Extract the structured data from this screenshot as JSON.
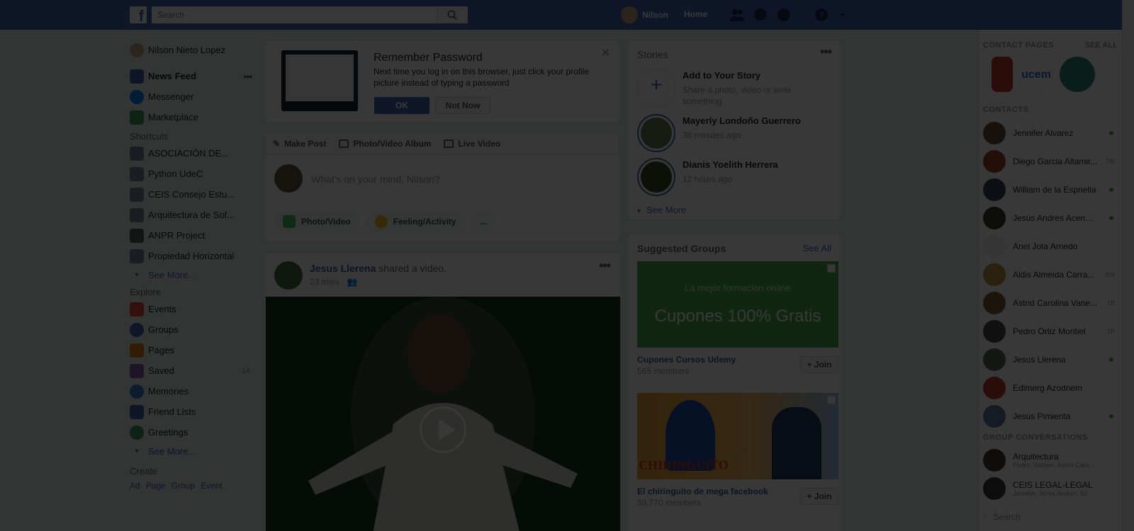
{
  "topbar": {
    "logo": "f",
    "search_placeholder": "Search",
    "user_name": "Nilson",
    "home_label": "Home",
    "icons": [
      "friends-icon",
      "messenger-icon",
      "globe-icon",
      "help-icon",
      "caret-down-icon"
    ]
  },
  "leftnav": {
    "profile": "Nilson Nieto Lopez",
    "main": [
      {
        "label": "News Feed",
        "icon_color": "#4267b2"
      },
      {
        "label": "Messenger",
        "icon_color": "#0084ff"
      },
      {
        "label": "Marketplace",
        "icon_color": "#3b9c5c"
      }
    ],
    "shortcuts_title": "Shortcuts",
    "shortcuts": [
      "ASOCIACIÓN DE...",
      "Python UdeC",
      "CEIS Consejo Estu...",
      "Arquitectura de Sof...",
      "ANPR Project",
      "Propiedad Horizontal"
    ],
    "shortcuts_more": "See More...",
    "explore_title": "Explore",
    "explore": [
      {
        "label": "Events",
        "icon_color": "#e74c3c",
        "count": ""
      },
      {
        "label": "Groups",
        "icon_color": "#4267b2",
        "count": ""
      },
      {
        "label": "Pages",
        "icon_color": "#e67e22",
        "count": ""
      },
      {
        "label": "Saved",
        "icon_color": "#8b5cb8",
        "count": "14"
      },
      {
        "label": "Memories",
        "icon_color": "#3b7bd6",
        "count": ""
      },
      {
        "label": "Friend Lists",
        "icon_color": "#4267b2",
        "count": ""
      },
      {
        "label": "Greetings",
        "icon_color": "#3b9c5c",
        "count": ""
      }
    ],
    "explore_more": "See More...",
    "create_title": "Create",
    "create_links": [
      "Ad",
      "Page",
      "Group",
      "Event"
    ]
  },
  "reminder": {
    "title": "Remember Password",
    "text": "Next time you log in on this browser, just click your profile picture instead of typing a password",
    "ok": "OK",
    "not_now": "Not Now"
  },
  "composer": {
    "tabs": [
      "Make Post",
      "Photo/Video Album",
      "Live Video"
    ],
    "placeholder": "What's on your mind, Nilson?",
    "actions": [
      {
        "label": "Photo/Video",
        "color": "#45bd62"
      },
      {
        "label": "Feeling/Activity",
        "color": "#f7b928"
      }
    ],
    "more": "..."
  },
  "post": {
    "author": "Jesus Llerena",
    "action": "shared a video.",
    "time": "23 mins · "
  },
  "stories": {
    "title": "Stories",
    "add_title": "Add to Your Story",
    "add_sub": "Share a photo, video or write something",
    "items": [
      {
        "name": "Mayerly Londoño Guerrero",
        "time": "38 minutes ago"
      },
      {
        "name": "Dianis Yoelith Herrera",
        "time": "12 hours ago"
      }
    ],
    "see_more": "See More"
  },
  "groups": {
    "title": "Suggested Groups",
    "see_all": "See All",
    "items": [
      {
        "name": "Cupones Cursos Udemy",
        "members": "565 members",
        "img_line1": "La mejor formación online",
        "img_line2": "Cupones 100% Gratis",
        "join": "+ Join"
      },
      {
        "name": "El chiringuito de mega facebook",
        "members": "39,770 members",
        "img_line1": "CHIRINGUITO",
        "img_line2": "",
        "join": "+ Join"
      }
    ]
  },
  "chat": {
    "contact_pages": "CONTACT PAGES",
    "see_all": "SEE ALL",
    "contacts_title": "CONTACTS",
    "contacts": [
      {
        "name": "Jennifer Alvarez",
        "status": "online"
      },
      {
        "name": "Diego Garcia Altamir...",
        "status": "7m"
      },
      {
        "name": "William de la Espriella",
        "status": "online"
      },
      {
        "name": "Jesús Andrés Acendr...",
        "status": "online"
      },
      {
        "name": "Anel Jota Arnedo",
        "status": ""
      },
      {
        "name": "Aldis Almeida Carra...",
        "status": "8m"
      },
      {
        "name": "Astrid Carolina Vane...",
        "status": "1h"
      },
      {
        "name": "Pedro Ortiz Montiel",
        "status": "1h"
      },
      {
        "name": "Jesus Llerena",
        "status": "online"
      },
      {
        "name": "Edimerg Azodnem",
        "status": ""
      },
      {
        "name": "Jesús Pimienta",
        "status": "online"
      }
    ],
    "group_conv_title": "GROUP CONVERSATIONS",
    "groups": [
      {
        "name": "Arquitectura",
        "sub": "Pedro, William, Astrid Caro..."
      },
      {
        "name": "CEIS LEGAL-LEGAL",
        "sub": "Jennifer, Jesús Andrés, Er..."
      }
    ],
    "search_placeholder": "Search"
  }
}
